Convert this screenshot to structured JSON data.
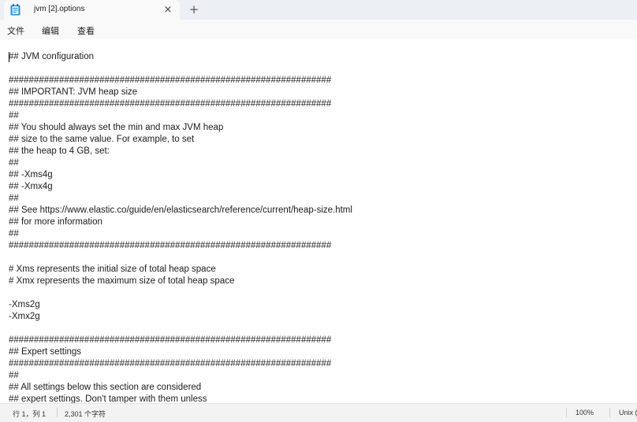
{
  "window": {
    "tab_title": "jvm [2].options",
    "close_symbol": "×",
    "new_tab_symbol": "+"
  },
  "menu": {
    "items": [
      "文件",
      "编辑",
      "查看"
    ]
  },
  "editor": {
    "lines": [
      "## JVM configuration",
      "",
      "################################################################",
      "## IMPORTANT: JVM heap size",
      "################################################################",
      "##",
      "## You should always set the min and max JVM heap",
      "## size to the same value. For example, to set",
      "## the heap to 4 GB, set:",
      "##",
      "## -Xms4g",
      "## -Xmx4g",
      "##",
      "## See https://www.elastic.co/guide/en/elasticsearch/reference/current/heap-size.html",
      "## for more information",
      "##",
      "################################################################",
      "",
      "# Xms represents the initial size of total heap space",
      "# Xmx represents the maximum size of total heap space",
      "",
      "-Xms2g",
      "-Xmx2g",
      "",
      "################################################################",
      "## Expert settings",
      "################################################################",
      "##",
      "## All settings below this section are considered",
      "## expert settings. Don't tamper with them unless"
    ]
  },
  "statusbar": {
    "position": "行 1，列 1",
    "char_count": "2,301 个字符",
    "zoom": "100%",
    "line_ending": "Unix (LF)"
  }
}
